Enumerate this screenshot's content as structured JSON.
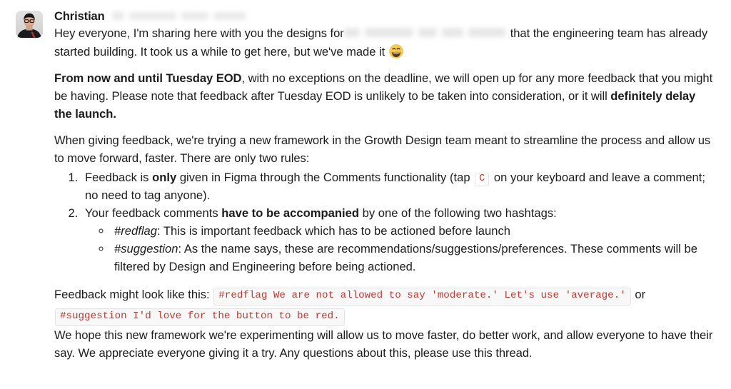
{
  "message": {
    "author": "Christian",
    "avatar_alt": "avatar",
    "metadata_redacted": true,
    "paragraphs": {
      "p1_before": "Hey everyone, I'm sharing here with you the designs for",
      "p1_redacted": true,
      "p1_after": "that the engineering team has already started building. It took us a while to get here, but we've made it",
      "p1_emoji": "grinning-face-with-smiling-eyes",
      "p2_bold_lead": "From now and until Tuesday EOD",
      "p2_mid": ", with no exceptions on the deadline, we will open up for any more feedback that you might be having. Please note that feedback after Tuesday EOD is unlikely to be taken into consideration, or it will ",
      "p2_bold_end": "definitely delay the launch.",
      "p3": "When giving feedback, we're trying a new framework in the Growth Design team meant to streamline the process and allow us to move forward, faster. There are only two rules:",
      "p_last": "We hope this new framework we're experimenting will allow us to move faster, do better work, and allow everyone to have their say. We appreciate everyone giving it a try. Any questions about this, please use this thread."
    },
    "rules": {
      "rule1_a": "Feedback is ",
      "rule1_bold": "only",
      "rule1_b": " given in Figma through the Comments functionality (tap ",
      "rule1_key": "C",
      "rule1_c": " on your keyboard and leave a comment; no need to tag anyone).",
      "rule2_a": "Your feedback comments ",
      "rule2_bold": "have to be accompanied",
      "rule2_b": " by one of the following two hashtags:",
      "subrules": [
        {
          "tag": "#redflag",
          "separator": ":",
          "text": " This is important feedback which has to be actioned before launch"
        },
        {
          "tag": "#suggestion",
          "separator": ":",
          "text": " As the name says, these are recommendations/suggestions/preferences. These comments will be filtered by Design and Engineering before being actioned."
        }
      ]
    },
    "feedback_example": {
      "lead": "Feedback might look like this:",
      "code_1": "#redflag We are not allowed to say 'moderate.' Let's use 'average.'",
      "joiner": "or",
      "code_2": "#suggestion I'd love for the button to be red."
    },
    "colors": {
      "text": "#1d1c1d",
      "code_red": "#c0392f",
      "code_bg": "#f8f8f8",
      "code_border": "#e3e3e4",
      "emoji_yellow": "#f4c430"
    }
  }
}
